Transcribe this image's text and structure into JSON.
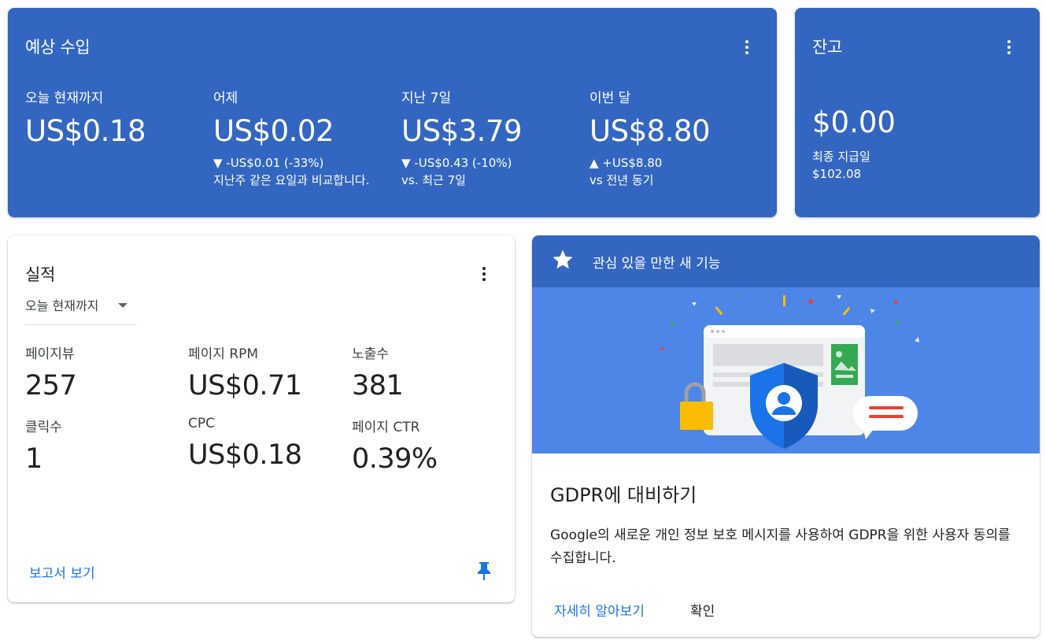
{
  "earnings": {
    "title": "예상 수입",
    "metrics": [
      {
        "label": "오늘 현재까지",
        "value": "US$0.18",
        "change": "",
        "compare": ""
      },
      {
        "label": "어제",
        "value": "US$0.02",
        "change": "▼ -US$0.01 (-33%)",
        "compare": "지난주 같은 요일과 비교합니다."
      },
      {
        "label": "지난 7일",
        "value": "US$3.79",
        "change": "▼ -US$0.43 (-10%)",
        "compare": "vs. 최근 7일"
      },
      {
        "label": "이번 달",
        "value": "US$8.80",
        "change": "▲ +US$8.80",
        "compare": "vs 전년 동기"
      }
    ]
  },
  "balance": {
    "title": "잔고",
    "amount": "$0.00",
    "last_payment_label": "최종 지급일",
    "last_payment_amount": "$102.08"
  },
  "performance": {
    "title": "실적",
    "range": "오늘 현재까지",
    "metrics": [
      {
        "label": "페이지뷰",
        "value": "257"
      },
      {
        "label": "페이지 RPM",
        "value": "US$0.71"
      },
      {
        "label": "노출수",
        "value": "381"
      },
      {
        "label": "클릭수",
        "value": "1"
      },
      {
        "label": "CPC",
        "value": "US$0.18"
      },
      {
        "label": "페이지 CTR",
        "value": "0.39%"
      }
    ],
    "report_link": "보고서 보기"
  },
  "feature": {
    "header": "관심 있을 만한 새 기능",
    "title": "GDPR에 대비하기",
    "description": "Google의 새로운 개인 정보 보호 메시지를 사용하여 GDPR을 위한 사용자 동의를 수집합니다.",
    "learn_more": "자세히 알아보기",
    "confirm": "확인"
  },
  "colors": {
    "card_blue": "#3366c0",
    "illustration_blue": "#4d86e6",
    "link_blue": "#1a73e8"
  }
}
